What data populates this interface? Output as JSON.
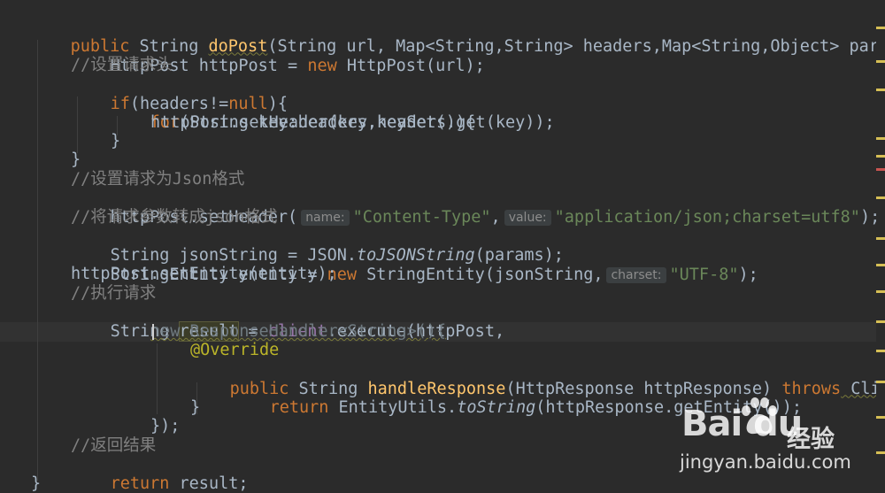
{
  "code": {
    "l1": {
      "kw": "public",
      "t1": " String ",
      "method": "doPost",
      "t2": "(String url, Map<String,String> headers,Map<String,Object> params"
    },
    "l2": {
      "t1": "HttpPost httpPost = ",
      "kw": "new",
      "t2": " HttpPost(url);"
    },
    "l3": {
      "comment": "//设置请求头"
    },
    "l4": {
      "kw": "if",
      "t1": "(headers!=",
      "kw2": "null",
      "t2": "){"
    },
    "l5": {
      "kw": "for",
      "t1": "(String key:headers.keySet()){"
    },
    "l6": {
      "text": "httpPost.setHeader(key,headers.get(key));"
    },
    "l7": {
      "text": "}"
    },
    "l8": {
      "text": "}"
    },
    "l9": {
      "comment": "//设置请求为Json格式"
    },
    "l10": {
      "t1": "httpPost.setHeader(",
      "hint1": "name:",
      "s1": "\"Content-Type\"",
      "t2": ",",
      "hint2": "value:",
      "s2": "\"application/json;charset=utf8\"",
      "t3": ");"
    },
    "l11": {
      "comment": "//将请求参数转成json格式"
    },
    "l12": {
      "t1": "String jsonString = JSON.",
      "italic": "toJSONString",
      "t2": "(params);"
    },
    "l13": {
      "t1": "StringEntity entity = ",
      "kw": "new",
      "t2": " StringEntity(jsonString,",
      "hint": "charset:",
      "s": "\"UTF-8\"",
      "t3": ");"
    },
    "l14": {
      "text": "httpPost.setEntity(entity);"
    },
    "l15": {
      "comment": "//执行请求"
    },
    "l16": {
      "t1": "String ",
      "var": "result",
      "t2": " = ",
      "field": "client",
      "t3": ".execute(httpPost,"
    },
    "l17": {
      "text": "new ResponseHandler<String>(){"
    },
    "l18": {
      "annotation": "@Override"
    },
    "l19": {
      "kw": "public",
      "t1": " String ",
      "method": "handleResponse",
      "t2": "(HttpResponse httpResponse) ",
      "kw2": "throws",
      "t3": " ClientP"
    },
    "l20": {
      "kw": "return",
      "t1": " EntityUtils.",
      "italic": "toString",
      "t2": "(httpResponse.getEntity());"
    },
    "l21": {
      "text": "}"
    },
    "l22": {
      "text": "});"
    },
    "l23": {
      "comment": "//返回结果"
    },
    "l24": {
      "kw": "return",
      "t1": " result;"
    },
    "l25": {
      "text": "}"
    }
  },
  "watermark": {
    "brand": "Bai du",
    "jingyan": "经验",
    "url": "jingyan.baidu.com"
  },
  "colors": {
    "background": "#2b2b2b",
    "keyword": "#cc7832",
    "string": "#6a8759",
    "method": "#ffc66d",
    "comment": "#808080",
    "annotation": "#bbb529",
    "field": "#9876aa",
    "text": "#a9b7c6"
  }
}
